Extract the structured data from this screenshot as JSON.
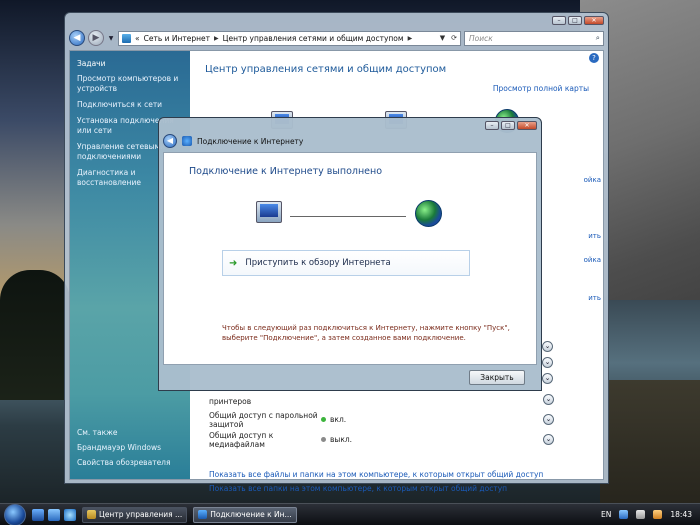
{
  "main_window": {
    "address": {
      "crumb_root": "«",
      "crumb1": "Сеть и Интернет",
      "crumb2": "Центр управления сетями и общим доступом",
      "search_placeholder": "Поиск"
    },
    "sidebar": {
      "tasks_title": "Задачи",
      "items": [
        {
          "label": "Просмотр компьютеров и устройств"
        },
        {
          "label": "Подключиться к сети"
        },
        {
          "label": "Установка подключения или сети"
        },
        {
          "label": "Управление сетевыми подключениями"
        },
        {
          "label": "Диагностика и восстановление"
        }
      ],
      "see_also": "См. также",
      "see_also_items": [
        {
          "label": "Брандмауэр Windows"
        },
        {
          "label": "Свойства обозревателя"
        }
      ]
    },
    "main": {
      "title": "Центр управления сетями и общим доступом",
      "full_map": "Просмотр полной карты",
      "edge_fragments": [
        "ойка",
        "ить",
        "ойка",
        "ить"
      ]
    },
    "sharing_rows": [
      {
        "label": "принтеров",
        "value": ""
      },
      {
        "label": "Общий доступ с парольной защитой",
        "value": "вкл.",
        "status": "on"
      },
      {
        "label": "Общий доступ к медиафайлам",
        "value": "выкл.",
        "status": "off"
      }
    ],
    "bottom_links": [
      "Показать все файлы и папки на этом компьютере, к которым открыт общий доступ",
      "Показать все папки на этом компьютере, к которым открыт общий доступ"
    ]
  },
  "dialog": {
    "title": "Подключение к Интернету",
    "heading": "Подключение к Интернету выполнено",
    "browse_label": "Приступить к обзору Интернета",
    "note": "Чтобы в следующий раз подключиться к Интернету, нажмите кнопку \"Пуск\", выберите \"Подключение\", а затем созданное вами подключение.",
    "close_label": "Закрыть"
  },
  "taskbar": {
    "tasks": [
      {
        "label": "Центр управления ..."
      },
      {
        "label": "Подключение к Ин..."
      }
    ],
    "language": "EN",
    "time": "18:43"
  },
  "colors": {
    "title_blue": "#1e5a9a",
    "link_blue": "#1a5ab8",
    "sidebar_teal": "#3c88a4",
    "note_red": "#7a2a1a",
    "status_on": "#3cb43c",
    "status_off": "#8a8a8a"
  }
}
